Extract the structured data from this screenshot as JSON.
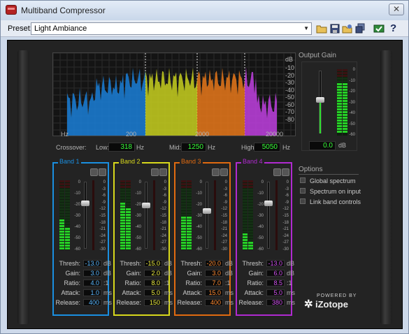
{
  "window": {
    "title": "Multiband Compressor",
    "close_label": "✕"
  },
  "toolbar": {
    "preset_label": "Preset:",
    "preset_value": "Light Ambiance",
    "icons": [
      "open-folder-icon",
      "save-icon",
      "save-as-icon",
      "copy-icon",
      "apply-icon",
      "help-icon"
    ],
    "help_label": "?"
  },
  "spectrum": {
    "db_unit": "dB",
    "db_labels": [
      "-10",
      "-20",
      "-30",
      "-40",
      "-50",
      "-60",
      "-70",
      "-80"
    ],
    "freq_unit": "Hz",
    "freq_labels": [
      "200",
      "2000",
      "20000"
    ]
  },
  "crossover": {
    "label": "Crossover:",
    "low_label": "Low:",
    "low_value": "318",
    "low_unit": "Hz",
    "mid_label": "Mid:",
    "mid_value": "1250",
    "mid_unit": "Hz",
    "high_label": "High:",
    "high_value": "5050",
    "high_unit": "Hz"
  },
  "output_gain": {
    "title": "Output Gain",
    "value": "0.0",
    "unit": "dB",
    "scale": [
      "0",
      "-10",
      "-20",
      "-30",
      "-40",
      "-50",
      "-60"
    ]
  },
  "band_scale": [
    "0",
    "-3",
    "-6",
    "-9",
    "-12",
    "-15",
    "-18",
    "-21",
    "-24",
    "-27",
    "-30"
  ],
  "fader_scale": [
    "0",
    "-10",
    "-20",
    "-30",
    "-40",
    "-50",
    "-60"
  ],
  "param_labels": {
    "thresh": "Thresh:",
    "gain": "Gain:",
    "ratio": "Ratio:",
    "attack": "Attack:",
    "release": "Release:"
  },
  "param_units": {
    "thresh": "dB",
    "gain": "dB",
    "ratio": ":1",
    "attack": "ms",
    "release": "ms"
  },
  "bands": [
    {
      "name": "Band 1",
      "color": "#1a8fe0",
      "text_color": "#5ab8ff",
      "thresh": "-13.0",
      "gain": "3.0",
      "ratio": "4.0",
      "attack": "1.0",
      "release": "400",
      "meter_level": 0.45,
      "meter_level2": 0.35
    },
    {
      "name": "Band 2",
      "color": "#d8d81c",
      "text_color": "#f0f040",
      "thresh": "-15.0",
      "gain": "2.0",
      "ratio": "8.0",
      "attack": "5.0",
      "release": "150",
      "meter_level": 0.7,
      "meter_level2": 0.6
    },
    {
      "name": "Band 3",
      "color": "#e06a10",
      "text_color": "#ff8a30",
      "thresh": "-20.0",
      "gain": "3.0",
      "ratio": "7.0",
      "attack": "15.0",
      "release": "400",
      "meter_level": 0.5,
      "meter_level2": 0.5
    },
    {
      "name": "Band 4",
      "color": "#b02ad0",
      "text_color": "#d050f0",
      "thresh": "-13.0",
      "gain": "6.0",
      "ratio": "8.5",
      "attack": "5.0",
      "release": "380",
      "meter_level": 0.25,
      "meter_level2": 0.15
    }
  ],
  "options": {
    "title": "Options",
    "items": [
      "Global spectrum",
      "Spectrum on input",
      "Link band controls"
    ]
  },
  "brand": {
    "powered_by": "POWERED BY",
    "name": "iZotope"
  }
}
